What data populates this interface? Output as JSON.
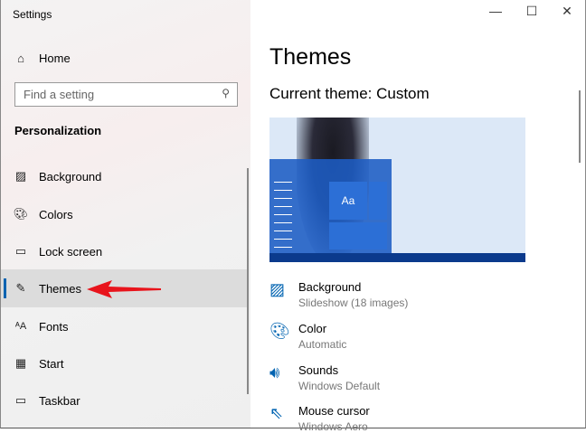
{
  "window": {
    "title": "Settings",
    "minimize": "—",
    "maximize": "☐",
    "close": "✕"
  },
  "sidebar": {
    "home": "Home",
    "search_placeholder": "Find a setting",
    "section": "Personalization",
    "items": [
      {
        "label": "Background"
      },
      {
        "label": "Colors"
      },
      {
        "label": "Lock screen"
      },
      {
        "label": "Themes"
      },
      {
        "label": "Fonts"
      },
      {
        "label": "Start"
      },
      {
        "label": "Taskbar"
      }
    ]
  },
  "main": {
    "heading": "Themes",
    "current_theme": "Current theme: Custom",
    "preview_tile_text": "Aa",
    "settings": [
      {
        "title": "Background",
        "value": "Slideshow (18 images)"
      },
      {
        "title": "Color",
        "value": "Automatic"
      },
      {
        "title": "Sounds",
        "value": "Windows Default"
      },
      {
        "title": "Mouse cursor",
        "value": "Windows Aero"
      }
    ]
  },
  "colors": {
    "accent": "#0063b1",
    "preview_bg": "#dce8f7",
    "start_menu": "#1d5cc4",
    "taskbar": "#0b3a8c",
    "annotation_arrow": "#e8141c"
  }
}
